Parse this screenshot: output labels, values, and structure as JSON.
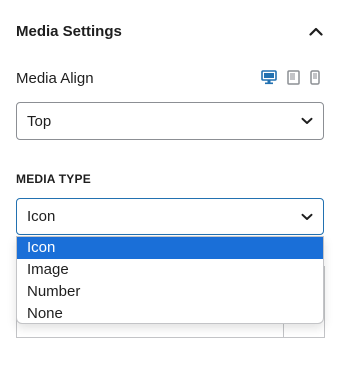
{
  "panel": {
    "title": "Media Settings",
    "collapse_icon": "chevron-up-icon"
  },
  "media_align": {
    "label": "Media Align",
    "devices": [
      {
        "name": "desktop-icon",
        "active": true
      },
      {
        "name": "tablet-icon",
        "active": false
      },
      {
        "name": "mobile-icon",
        "active": false
      }
    ],
    "value": "Top"
  },
  "media_type": {
    "label": "MEDIA TYPE",
    "value": "Icon",
    "options": [
      "Icon",
      "Image",
      "Number",
      "None"
    ],
    "selected_index": 0
  },
  "colors": {
    "accent": "#2271b1",
    "selected_bg": "#1a6fd8",
    "border": "#8c8f94"
  }
}
